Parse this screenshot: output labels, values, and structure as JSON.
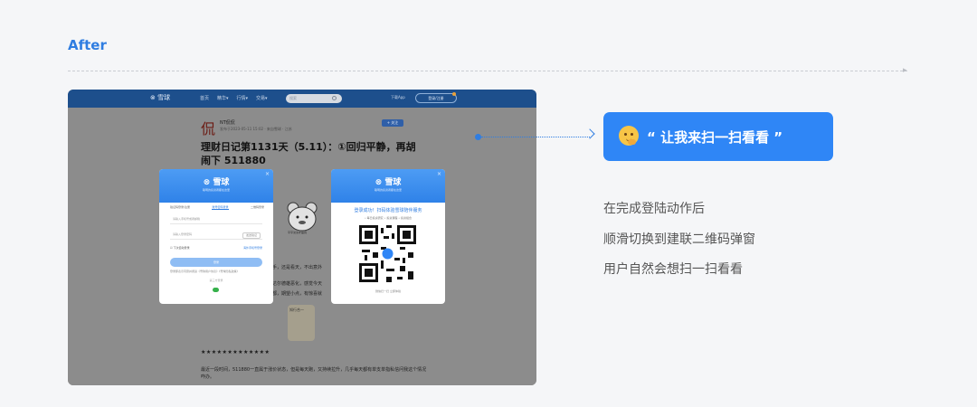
{
  "header": {
    "label": "After"
  },
  "screenshot": {
    "nav": {
      "logo": "雪球",
      "items": [
        "首页",
        "精华▾",
        "行情▾",
        "交易▾"
      ],
      "search_placeholder": "搜索",
      "app": "下载App",
      "login": "登录/注册"
    },
    "article": {
      "avatar_char": "侃",
      "author": "NT侃侃",
      "meta": "发布于2023-05-11 15:02 · 来自雪球 · 江苏",
      "follow": "+ 关注",
      "title": "理财日记第1131天（5.11）：①回归平静，再胡闹下 511880",
      "line1": "手，还是看天，不出意外",
      "line2": "达尔德雄恶化，感觉今天",
      "line3": "都，期望小点，有惊喜就",
      "bear_caption": "平平淡淡才是真",
      "cat_label": "知行合一",
      "stars": "★★★★★★★★★★★★★",
      "para": "最近一段时间，511880一直属于涨价状态，但是每天跑，又持续拉升，几乎每天都有单支单指私信问我这个情况咋办。"
    },
    "login_modal": {
      "logo": "雪球",
      "tagline": "聪明的投资者都在这里",
      "close": "×",
      "tabs": [
        "验证码登录/注册",
        "账号密码登录",
        "二维码登录"
      ],
      "phone_placeholder": "请输入手机号或者邮箱",
      "code_placeholder": "请输入登录密码",
      "code_btn": "发送验证",
      "remember": "下次自动登录",
      "forgot": "海外手机号登录",
      "submit": "登录",
      "agree": "登录即表示同意并阅读《雪球用户协议》《雪球隐私政策》",
      "third": "第三方登录"
    },
    "qr_modal": {
      "logo": "雪球",
      "tagline": "聪明的投资者都在这里",
      "close": "×",
      "success": "登录成功！扫码体验雪球陪伴服务",
      "perks": "• 每日投资研究   • 投资课程   • 投资组合",
      "footer": "微信扫一扫 立即体验"
    }
  },
  "callout": {
    "text": "“ 让我来扫一扫看看 ”",
    "emoji": "thinking-face-icon"
  },
  "description": [
    "在完成登陆动作后",
    "顺滑切换到建联二维码弹窗",
    "用户自然会想扫一扫看看"
  ],
  "colors": {
    "accent": "#2f86f6",
    "nav": "#1d4f8c"
  }
}
